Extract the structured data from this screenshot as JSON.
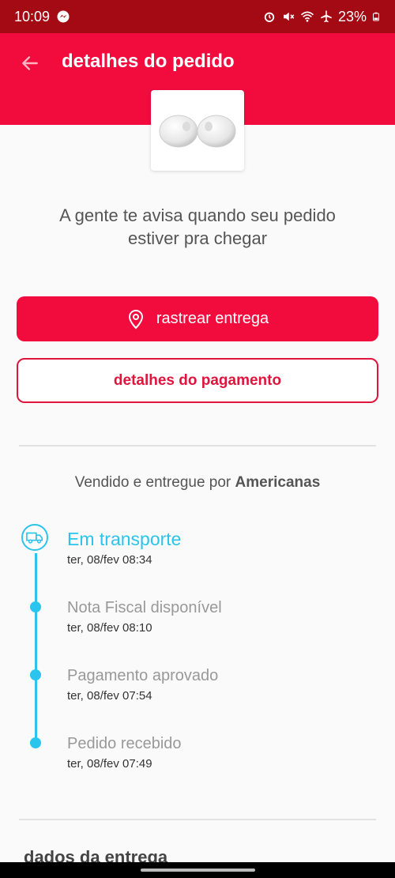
{
  "status_bar": {
    "time": "10:09",
    "battery": "23%",
    "icons": [
      "messenger-icon",
      "alarm-icon",
      "mute-icon",
      "wifi-icon",
      "airplane-icon",
      "battery-icon"
    ]
  },
  "header": {
    "title": "detalhes do pedido",
    "back_icon": "arrow-left-icon",
    "color": "#f20c3e"
  },
  "product": {
    "image": "white-earbuds"
  },
  "message": "A gente te avisa quando seu pedido estiver pra chegar",
  "buttons": {
    "track": "rastrear entrega",
    "track_icon": "location-pin-icon",
    "payment": "detalhes do pagamento"
  },
  "seller": {
    "prefix": "Vendido e entregue por",
    "name": "Americanas"
  },
  "timeline": [
    {
      "title": "Em transporte",
      "date": "ter, 08/fev 08:34",
      "active": true,
      "icon": "truck-icon"
    },
    {
      "title": "Nota Fiscal disponível",
      "date": "ter, 08/fev 08:10",
      "active": false
    },
    {
      "title": "Pagamento aprovado",
      "date": "ter, 08/fev 07:54",
      "active": false
    },
    {
      "title": "Pedido recebido",
      "date": "ter, 08/fev 07:49",
      "active": false
    }
  ],
  "timeline_color": "#2bc4ec",
  "delivery_section_title": "dados da entrega"
}
